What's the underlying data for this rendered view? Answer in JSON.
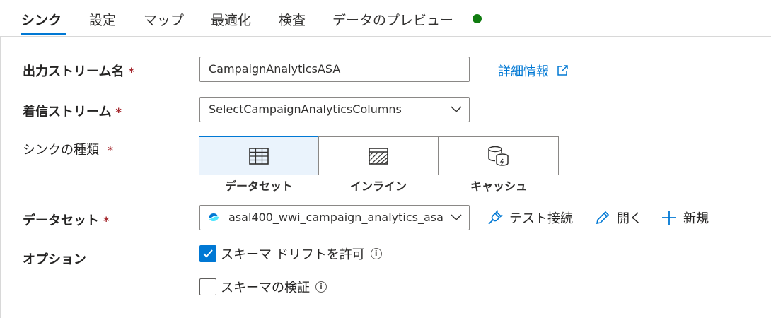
{
  "tabs": [
    {
      "label": "シンク",
      "active": true
    },
    {
      "label": "設定"
    },
    {
      "label": "マップ"
    },
    {
      "label": "最適化"
    },
    {
      "label": "検査"
    },
    {
      "label": "データのプレビュー"
    }
  ],
  "status_color": "#107c10",
  "output_stream": {
    "label": "出力ストリーム名",
    "required": "*",
    "value": "CampaignAnalyticsASA",
    "more_info": "詳細情報"
  },
  "incoming_stream": {
    "label": "着信ストリーム",
    "required": "*",
    "value": "SelectCampaignAnalyticsColumns"
  },
  "sink_type": {
    "label": "シンクの種類",
    "required": "*",
    "options": [
      {
        "label": "データセット",
        "icon": "table-icon",
        "selected": true
      },
      {
        "label": "インライン",
        "icon": "inline-icon"
      },
      {
        "label": "キャッシュ",
        "icon": "cache-icon"
      }
    ]
  },
  "dataset": {
    "label": "データセット",
    "required": "*",
    "value": "asal400_wwi_campaign_analytics_asa",
    "actions": {
      "test_connection": "テスト接続",
      "open": "開く",
      "new": "新規"
    }
  },
  "options": {
    "label": "オプション",
    "allow_schema_drift": {
      "label": "スキーマ ドリフトを許可",
      "checked": true
    },
    "validate_schema": {
      "label": "スキーマの検証",
      "checked": false
    },
    "info_glyph": "i"
  },
  "accent_color": "#0078d4"
}
